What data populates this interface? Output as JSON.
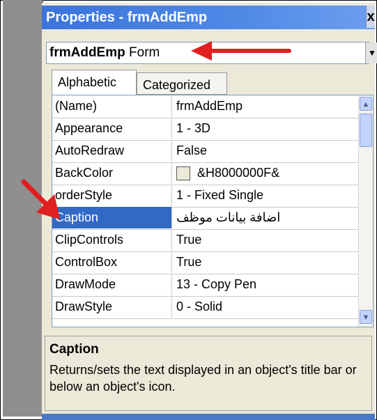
{
  "window": {
    "title": "Properties - frmAddEmp",
    "close_glyph": "x"
  },
  "object_selector": {
    "name": "frmAddEmp",
    "type": "Form"
  },
  "tabs": [
    {
      "label": "Alphabetic",
      "active": true
    },
    {
      "label": "Categorized",
      "active": false
    }
  ],
  "properties": [
    {
      "name": "(Name)",
      "value": "frmAddEmp"
    },
    {
      "name": "Appearance",
      "value": "1 - 3D"
    },
    {
      "name": "AutoRedraw",
      "value": "False"
    },
    {
      "name": "BackColor",
      "value": "&H8000000F&"
    },
    {
      "name": "orderStyle",
      "value": "1 - Fixed Single"
    },
    {
      "name": "Caption",
      "value": "اضافة بيانات موظف",
      "selected": true
    },
    {
      "name": "ClipControls",
      "value": "True"
    },
    {
      "name": "ControlBox",
      "value": "True"
    },
    {
      "name": "DrawMode",
      "value": "13 - Copy Pen"
    },
    {
      "name": "DrawStyle",
      "value": "0 - Solid"
    }
  ],
  "description": {
    "title": "Caption",
    "text": "Returns/sets the text displayed in an object's title bar or below an object's icon."
  },
  "colors": {
    "accent": "#316ac5",
    "titlebar": "#3b74dc",
    "arrow": "#e02020"
  }
}
